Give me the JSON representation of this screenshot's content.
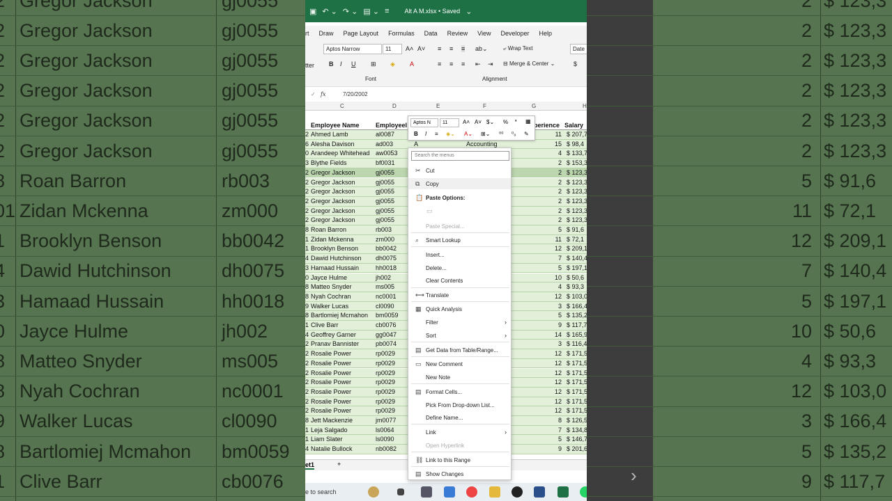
{
  "background": {
    "left_rows": [
      {
        "num": "2",
        "name": "Gregor Jackson",
        "id": "gj0055"
      },
      {
        "num": "2",
        "name": "Gregor Jackson",
        "id": "gj0055"
      },
      {
        "num": "2",
        "name": "Gregor Jackson",
        "id": "gj0055"
      },
      {
        "num": "2",
        "name": "Gregor Jackson",
        "id": "gj0055"
      },
      {
        "num": "2",
        "name": "Gregor Jackson",
        "id": "gj0055"
      },
      {
        "num": "2",
        "name": "Gregor Jackson",
        "id": "gj0055"
      },
      {
        "num": "8",
        "name": "Roan Barron",
        "id": "rb003"
      },
      {
        "num": "01",
        "name": "Zidan Mckenna",
        "id": "zm000"
      },
      {
        "num": "1",
        "name": "Brooklyn Benson",
        "id": "bb0042"
      },
      {
        "num": "4",
        "name": "Dawid Hutchinson",
        "id": "dh0075"
      },
      {
        "num": "3",
        "name": "Hamaad Hussain",
        "id": "hh0018"
      },
      {
        "num": "0",
        "name": "Jayce Hulme",
        "id": "jh002"
      },
      {
        "num": "8",
        "name": "Matteo Snyder",
        "id": "ms005"
      },
      {
        "num": "8",
        "name": "Nyah Cochran",
        "id": "nc0001"
      },
      {
        "num": "9",
        "name": "Walker Lucas",
        "id": "cl0090"
      },
      {
        "num": "8",
        "name": "Bartlomiej Mcmahon",
        "id": "bm0059"
      },
      {
        "num": "1",
        "name": "Clive Barr",
        "id": "cb0076"
      }
    ],
    "right_rows": [
      {
        "exp": "2",
        "salary": "$ 123,3"
      },
      {
        "exp": "2",
        "salary": "$ 123,3"
      },
      {
        "exp": "2",
        "salary": "$ 123,3"
      },
      {
        "exp": "2",
        "salary": "$ 123,3"
      },
      {
        "exp": "2",
        "salary": "$ 123,3"
      },
      {
        "exp": "2",
        "salary": "$ 123,3"
      },
      {
        "exp": "5",
        "salary": "$   91,6"
      },
      {
        "exp": "11",
        "salary": "$   72,1"
      },
      {
        "exp": "12",
        "salary": "$ 209,1"
      },
      {
        "exp": "7",
        "salary": "$ 140,4"
      },
      {
        "exp": "5",
        "salary": "$ 197,1"
      },
      {
        "exp": "10",
        "salary": "$   50,6"
      },
      {
        "exp": "4",
        "salary": "$   93,3"
      },
      {
        "exp": "12",
        "salary": "$ 103,0"
      },
      {
        "exp": "3",
        "salary": "$ 166,4"
      },
      {
        "exp": "5",
        "salary": "$ 135,2"
      },
      {
        "exp": "9",
        "salary": "$ 117,7"
      }
    ]
  },
  "titlebar": {
    "filename": "Alt A M.xlsx • Saved"
  },
  "menu": [
    "rt",
    "Draw",
    "Page Layout",
    "Formulas",
    "Data",
    "Review",
    "View",
    "Developer",
    "Help"
  ],
  "ribbon": {
    "font_name": "Aptos Narrow",
    "font_size": "11",
    "wrap_text": "Wrap Text",
    "merge_center": "Merge & Center",
    "number_format": "Date",
    "group_font": "Font",
    "group_alignment": "Alignment",
    "clipboard_partial": "tter",
    "currency": "$"
  },
  "formula_bar": {
    "fx": "fx",
    "value": "7/20/2002"
  },
  "columns": [
    "C",
    "D",
    "E",
    "F",
    "G",
    "H"
  ],
  "header": {
    "name": "Employee Name",
    "id": "EmployeeI",
    "exp": "perience",
    "salary": "Salary"
  },
  "rows": [
    {
      "n": "2",
      "name": "Ahmed Lamb",
      "id": "al0087",
      "e": "",
      "f": "",
      "exp": "11",
      "sal": "$ 207,7"
    },
    {
      "n": "6",
      "name": "Alesha Davison",
      "id": "ad003",
      "e": "A",
      "f": "Accounting",
      "exp": "15",
      "sal": "$   98,4"
    },
    {
      "n": "0",
      "name": "Arandeep Whitehead",
      "id": "aw0053",
      "e": "",
      "f": "",
      "exp": "4",
      "sal": "$ 133,7"
    },
    {
      "n": "3",
      "name": "Blythe Fields",
      "id": "bf0031",
      "e": "",
      "f": "",
      "exp": "2",
      "sal": "$ 153,3"
    },
    {
      "n": "2",
      "name": "Gregor Jackson",
      "id": "gj0055",
      "e": "",
      "f": "",
      "exp": "2",
      "sal": "$ 123,3"
    },
    {
      "n": "2",
      "name": "Gregor Jackson",
      "id": "gj0055",
      "e": "",
      "f": "",
      "exp": "2",
      "sal": "$ 123,3"
    },
    {
      "n": "2",
      "name": "Gregor Jackson",
      "id": "gj0055",
      "e": "",
      "f": "",
      "exp": "2",
      "sal": "$ 123,3"
    },
    {
      "n": "2",
      "name": "Gregor Jackson",
      "id": "gj0055",
      "e": "",
      "f": "",
      "exp": "2",
      "sal": "$ 123,3"
    },
    {
      "n": "2",
      "name": "Gregor Jackson",
      "id": "gj0055",
      "e": "",
      "f": "",
      "exp": "2",
      "sal": "$ 123,3"
    },
    {
      "n": "2",
      "name": "Gregor Jackson",
      "id": "gj0055",
      "e": "",
      "f": "",
      "exp": "2",
      "sal": "$ 123,3"
    },
    {
      "n": "8",
      "name": "Roan Barron",
      "id": "rb003",
      "e": "",
      "f": "",
      "exp": "5",
      "sal": "$   91,6"
    },
    {
      "n": "1",
      "name": "Zidan Mckenna",
      "id": "zm000",
      "e": "",
      "f": "",
      "exp": "11",
      "sal": "$   72,1"
    },
    {
      "n": "1",
      "name": "Brooklyn Benson",
      "id": "bb0042",
      "e": "",
      "f": "",
      "exp": "12",
      "sal": "$ 209,1"
    },
    {
      "n": "4",
      "name": "Dawid Hutchinson",
      "id": "dh0075",
      "e": "",
      "f": "",
      "exp": "7",
      "sal": "$ 140,4"
    },
    {
      "n": "3",
      "name": "Hamaad Hussain",
      "id": "hh0018",
      "e": "",
      "f": "",
      "exp": "5",
      "sal": "$ 197,1"
    },
    {
      "n": "0",
      "name": "Jayce Hulme",
      "id": "jh002",
      "e": "",
      "f": "",
      "exp": "10",
      "sal": "$   50,6"
    },
    {
      "n": "8",
      "name": "Matteo Snyder",
      "id": "ms005",
      "e": "",
      "f": "",
      "exp": "4",
      "sal": "$   93,3"
    },
    {
      "n": "8",
      "name": "Nyah Cochran",
      "id": "nc0001",
      "e": "",
      "f": "",
      "exp": "12",
      "sal": "$ 103,0"
    },
    {
      "n": "9",
      "name": "Walker Lucas",
      "id": "cl0090",
      "e": "",
      "f": "",
      "exp": "3",
      "sal": "$ 166,4"
    },
    {
      "n": "8",
      "name": "Bartlomiej Mcmahon",
      "id": "bm0059",
      "e": "",
      "f": "",
      "exp": "5",
      "sal": "$ 135,2"
    },
    {
      "n": "1",
      "name": "Clive Barr",
      "id": "cb0076",
      "e": "",
      "f": "",
      "exp": "9",
      "sal": "$ 117,7"
    },
    {
      "n": "4",
      "name": "Geoffrey Garner",
      "id": "gg0047",
      "e": "",
      "f": "",
      "exp": "14",
      "sal": "$ 165,9"
    },
    {
      "n": "2",
      "name": "Pranav Bannister",
      "id": "pb0074",
      "e": "",
      "f": "",
      "exp": "3",
      "sal": "$ 116,4"
    },
    {
      "n": "2",
      "name": "Rosalie Power",
      "id": "rp0029",
      "e": "",
      "f": "",
      "exp": "12",
      "sal": "$ 171,5"
    },
    {
      "n": "2",
      "name": "Rosalie Power",
      "id": "rp0029",
      "e": "",
      "f": "",
      "exp": "12",
      "sal": "$ 171,5"
    },
    {
      "n": "2",
      "name": "Rosalie Power",
      "id": "rp0029",
      "e": "",
      "f": "",
      "exp": "12",
      "sal": "$ 171,5"
    },
    {
      "n": "2",
      "name": "Rosalie Power",
      "id": "rp0029",
      "e": "",
      "f": "",
      "exp": "12",
      "sal": "$ 171,5"
    },
    {
      "n": "2",
      "name": "Rosalie Power",
      "id": "rp0029",
      "e": "",
      "f": "",
      "exp": "12",
      "sal": "$ 171,5"
    },
    {
      "n": "2",
      "name": "Rosalie Power",
      "id": "rp0029",
      "e": "",
      "f": "",
      "exp": "12",
      "sal": "$ 171,5"
    },
    {
      "n": "2",
      "name": "Rosalie Power",
      "id": "rp0029",
      "e": "",
      "f": "",
      "exp": "12",
      "sal": "$ 171,5"
    },
    {
      "n": "8",
      "name": "Jett Mackenzie",
      "id": "jm0077",
      "e": "",
      "f": "",
      "exp": "8",
      "sal": "$ 126,5"
    },
    {
      "n": "1",
      "name": "Leja Salgado",
      "id": "ls0064",
      "e": "",
      "f": "",
      "exp": "7",
      "sal": "$ 134,8"
    },
    {
      "n": "1",
      "name": "Liam Slater",
      "id": "ls0090",
      "e": "",
      "f": "",
      "exp": "5",
      "sal": "$ 146,7"
    },
    {
      "n": "4",
      "name": "Natalie Bullock",
      "id": "nb0082",
      "e": "",
      "f": "",
      "exp": "9",
      "sal": "$ 201,6"
    }
  ],
  "selected_row_index": 4,
  "sheet_tab": "et1",
  "add_sheet": "+",
  "taskbar_search": "e to search",
  "mini_toolbar": {
    "font": "Aptos N",
    "size": "11"
  },
  "context_menu": {
    "search_placeholder": "Search the menus",
    "cut": "Cut",
    "copy": "Copy",
    "paste_options": "Paste Options:",
    "paste_special": "Paste Special...",
    "smart_lookup": "Smart Lookup",
    "insert": "Insert...",
    "delete": "Delete...",
    "clear_contents": "Clear Contents",
    "translate": "Translate",
    "quick_analysis": "Quick Analysis",
    "filter": "Filter",
    "sort": "Sort",
    "get_data": "Get Data from Table/Range...",
    "new_comment": "New Comment",
    "new_note": "New Note",
    "format_cells": "Format Cells...",
    "pick_dropdown": "Pick From Drop-down List...",
    "define_name": "Define Name...",
    "link": "Link",
    "open_hyperlink": "Open Hyperlink",
    "link_range": "Link to this Range",
    "show_changes": "Show Changes"
  }
}
